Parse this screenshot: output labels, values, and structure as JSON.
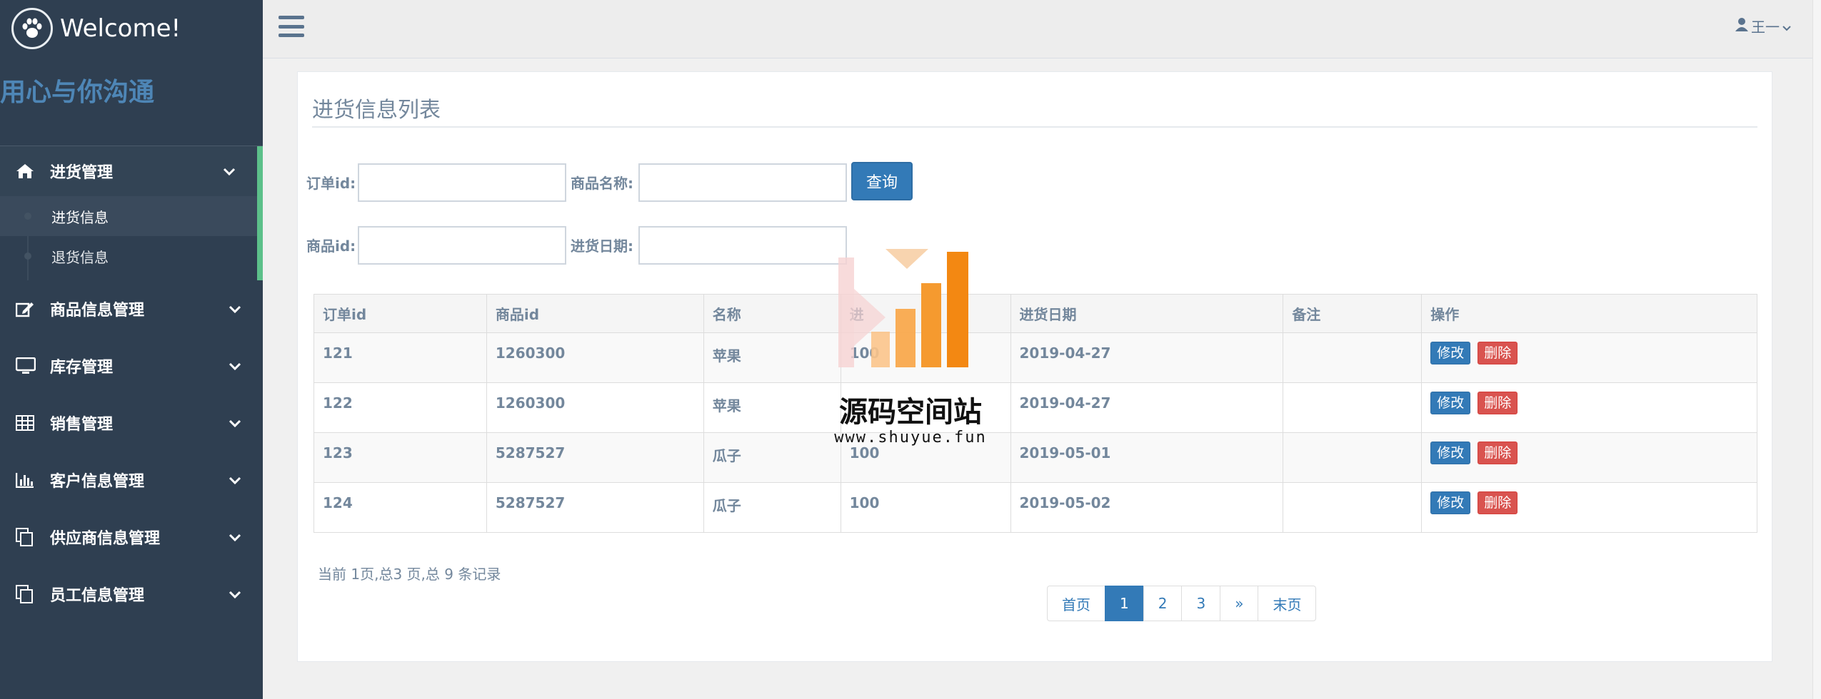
{
  "sidebar": {
    "brand": "Welcome!",
    "slogan": "用心与你沟通",
    "menu": [
      {
        "label": "进货管理",
        "icon": "home-icon"
      },
      {
        "label": "商品信息管理",
        "icon": "edit-icon"
      },
      {
        "label": "库存管理",
        "icon": "desktop-icon"
      },
      {
        "label": "销售管理",
        "icon": "table-icon"
      },
      {
        "label": "客户信息管理",
        "icon": "bar-chart-icon"
      },
      {
        "label": "供应商信息管理",
        "icon": "copy-icon"
      },
      {
        "label": "员工信息管理",
        "icon": "copy-icon"
      }
    ],
    "submenu": [
      {
        "label": "进货信息",
        "active": true
      },
      {
        "label": "退货信息",
        "active": false
      }
    ]
  },
  "topbar": {
    "user": "王一"
  },
  "panel": {
    "title": "进货信息列表"
  },
  "filters": {
    "order_id_label": "订单id:",
    "product_name_label": "商品名称:",
    "product_id_label": "商品id:",
    "date_label": "进货日期:",
    "order_id_value": "",
    "product_name_value": "",
    "product_id_value": "",
    "date_value": "",
    "search_label": "查询"
  },
  "table": {
    "headers": [
      "订单id",
      "商品id",
      "名称",
      "进",
      "进货日期",
      "备注",
      "操作"
    ],
    "rows": [
      {
        "order_id": "121",
        "product_id": "1260300",
        "name": "苹果",
        "qty": "100",
        "date": "2019-04-27",
        "note": ""
      },
      {
        "order_id": "122",
        "product_id": "1260300",
        "name": "苹果",
        "qty": "",
        "date": "2019-04-27",
        "note": ""
      },
      {
        "order_id": "123",
        "product_id": "5287527",
        "name": "瓜子",
        "qty": "100",
        "date": "2019-05-01",
        "note": ""
      },
      {
        "order_id": "124",
        "product_id": "5287527",
        "name": "瓜子",
        "qty": "100",
        "date": "2019-05-02",
        "note": ""
      }
    ],
    "edit_label": "修改",
    "delete_label": "删除"
  },
  "pagination": {
    "info": "当前 1页,总3 页,总 9 条记录",
    "first": "首页",
    "pages": [
      "1",
      "2",
      "3"
    ],
    "next": "»",
    "last": "末页",
    "current": "1"
  },
  "watermark": {
    "text": "源码空间站",
    "url": "www.shuyue.fun"
  },
  "colors": {
    "sidebar": "#2f3f51",
    "accent": "#5cc08a",
    "primary": "#337ab7",
    "danger": "#d9534f"
  }
}
